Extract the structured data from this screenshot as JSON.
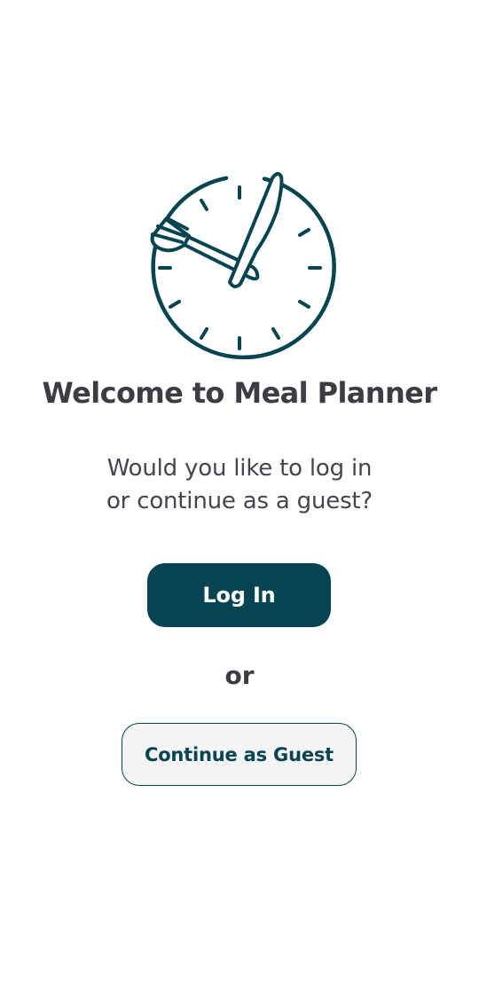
{
  "app": {
    "logo_icon": "clock-fork-knife-icon",
    "brand_color": "#064452",
    "title": "Welcome to Meal Planner",
    "subtitle_line1": "Would you like to log in",
    "subtitle_line2": "or continue as a guest?"
  },
  "actions": {
    "login_label": "Log In",
    "separator": "or",
    "guest_label": "Continue as Guest"
  }
}
